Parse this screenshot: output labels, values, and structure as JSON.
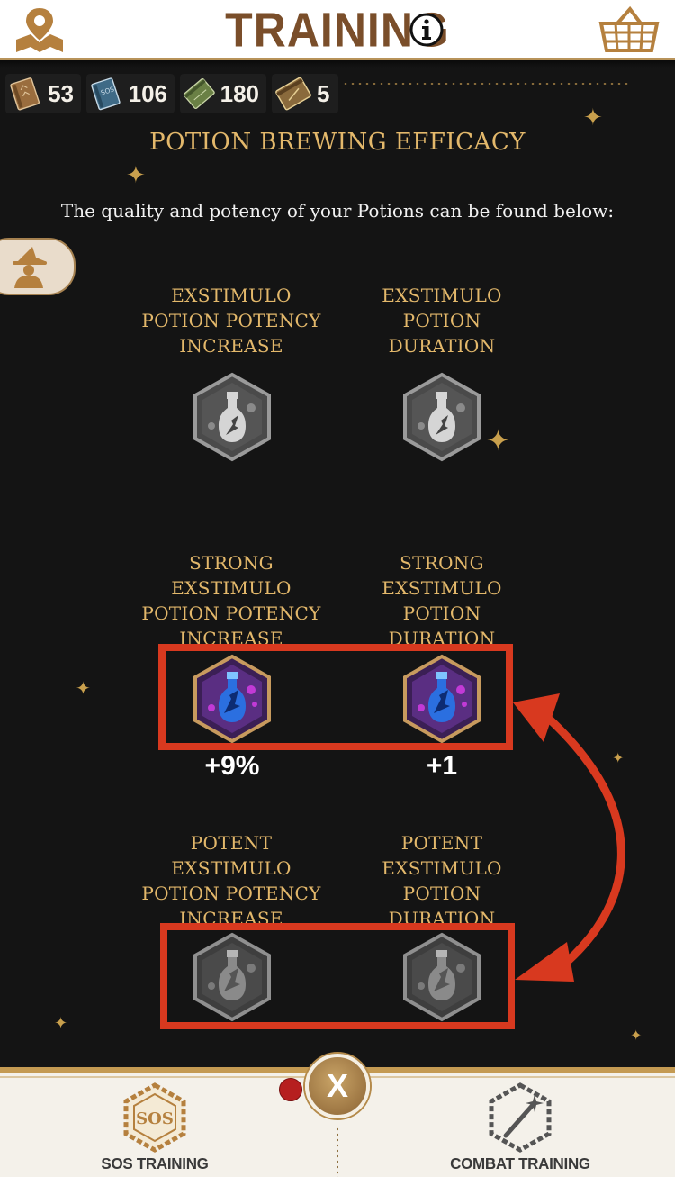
{
  "header": {
    "title": "TRAINING",
    "map_icon": "map-pin-icon",
    "info_icon": "info-icon",
    "shop_icon": "basket-icon"
  },
  "books": [
    {
      "icon": "brown-book-icon",
      "count": "53"
    },
    {
      "icon": "blue-sos-book-icon",
      "count": "106"
    },
    {
      "icon": "green-book-icon",
      "count": "180"
    },
    {
      "icon": "gold-book-icon",
      "count": "5"
    }
  ],
  "section": {
    "title": "POTION BREWING EFFICACY",
    "intro": "The quality and potency of your Potions can be found below:"
  },
  "skills": [
    {
      "label": [
        "EXSTIMULO",
        "POTION POTENCY",
        "INCREASE"
      ],
      "state": "locked",
      "value": ""
    },
    {
      "label": [
        "EXSTIMULO",
        "POTION",
        "DURATION"
      ],
      "state": "locked",
      "value": ""
    },
    {
      "label": [
        "STRONG",
        "EXSTIMULO",
        "POTION POTENCY",
        "INCREASE"
      ],
      "state": "unlocked",
      "value": "+9%"
    },
    {
      "label": [
        "STRONG",
        "EXSTIMULO",
        "POTION",
        "DURATION"
      ],
      "state": "unlocked",
      "value": "+1"
    },
    {
      "label": [
        "POTENT",
        "EXSTIMULO",
        "POTION POTENCY",
        "INCREASE"
      ],
      "state": "locked",
      "value": ""
    },
    {
      "label": [
        "POTENT",
        "EXSTIMULO",
        "POTION",
        "DURATION"
      ],
      "state": "locked",
      "value": ""
    }
  ],
  "bottom_nav": {
    "left_label": "SOS TRAINING",
    "left_badge": "SOS",
    "right_label": "COMBAT TRAINING",
    "close_label": "X"
  },
  "colors": {
    "accent_gold": "#e3b86b",
    "highlight_red": "#d8391f",
    "background": "#141414"
  }
}
